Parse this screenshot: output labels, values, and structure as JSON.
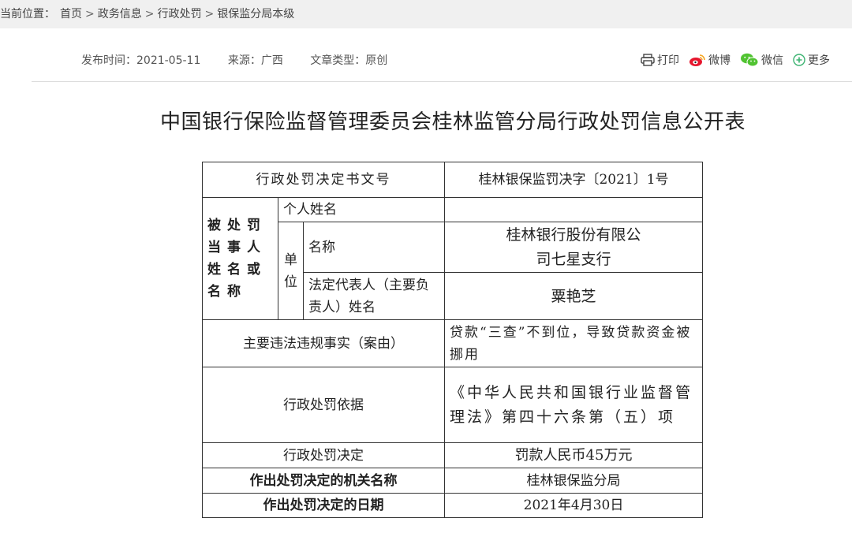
{
  "breadcrumb": {
    "label": "当前位置：",
    "items": [
      "首页",
      "政务信息",
      "行政处罚",
      "银保监分局本级"
    ],
    "separator": ">"
  },
  "meta": {
    "publish_time": "发布时间：2021-05-11",
    "source": "来源：广西",
    "type": "文章类型：原创"
  },
  "share": {
    "print": "打印",
    "weibo": "微博",
    "wechat": "微信",
    "more": "更多"
  },
  "title": "中国银行保险监督管理委员会桂林监管分局行政处罚信息公开表",
  "table": {
    "doc_no_label": "行政处罚决定书文号",
    "doc_no_value": "桂林银保监罚决字〔2021〕1号",
    "party_label": "被处罚当事人姓名或名称",
    "individual_label": "个人姓名",
    "individual_value": "",
    "unit_label": "单位",
    "unit_name_label": "名称",
    "unit_name_value": "桂林银行股份有限公司七星支行",
    "legal_rep_label": "法定代表人（主要负责人）姓名",
    "legal_rep_value": "粟艳芝",
    "facts_label": "主要违法违规事实（案由）",
    "facts_value": "贷款“三查”不到位，导致贷款资金被挪用",
    "basis_label": "行政处罚依据",
    "basis_value": "《中华人民共和国银行业监督管理法》第四十六条第（五）项",
    "decision_label": "行政处罚决定",
    "decision_value": "罚款人民币45万元",
    "authority_label": "作出处罚决定的机关名称",
    "authority_value": "桂林银保监分局",
    "date_label": "作出处罚决定的日期",
    "date_value": "2021年4月30日"
  }
}
